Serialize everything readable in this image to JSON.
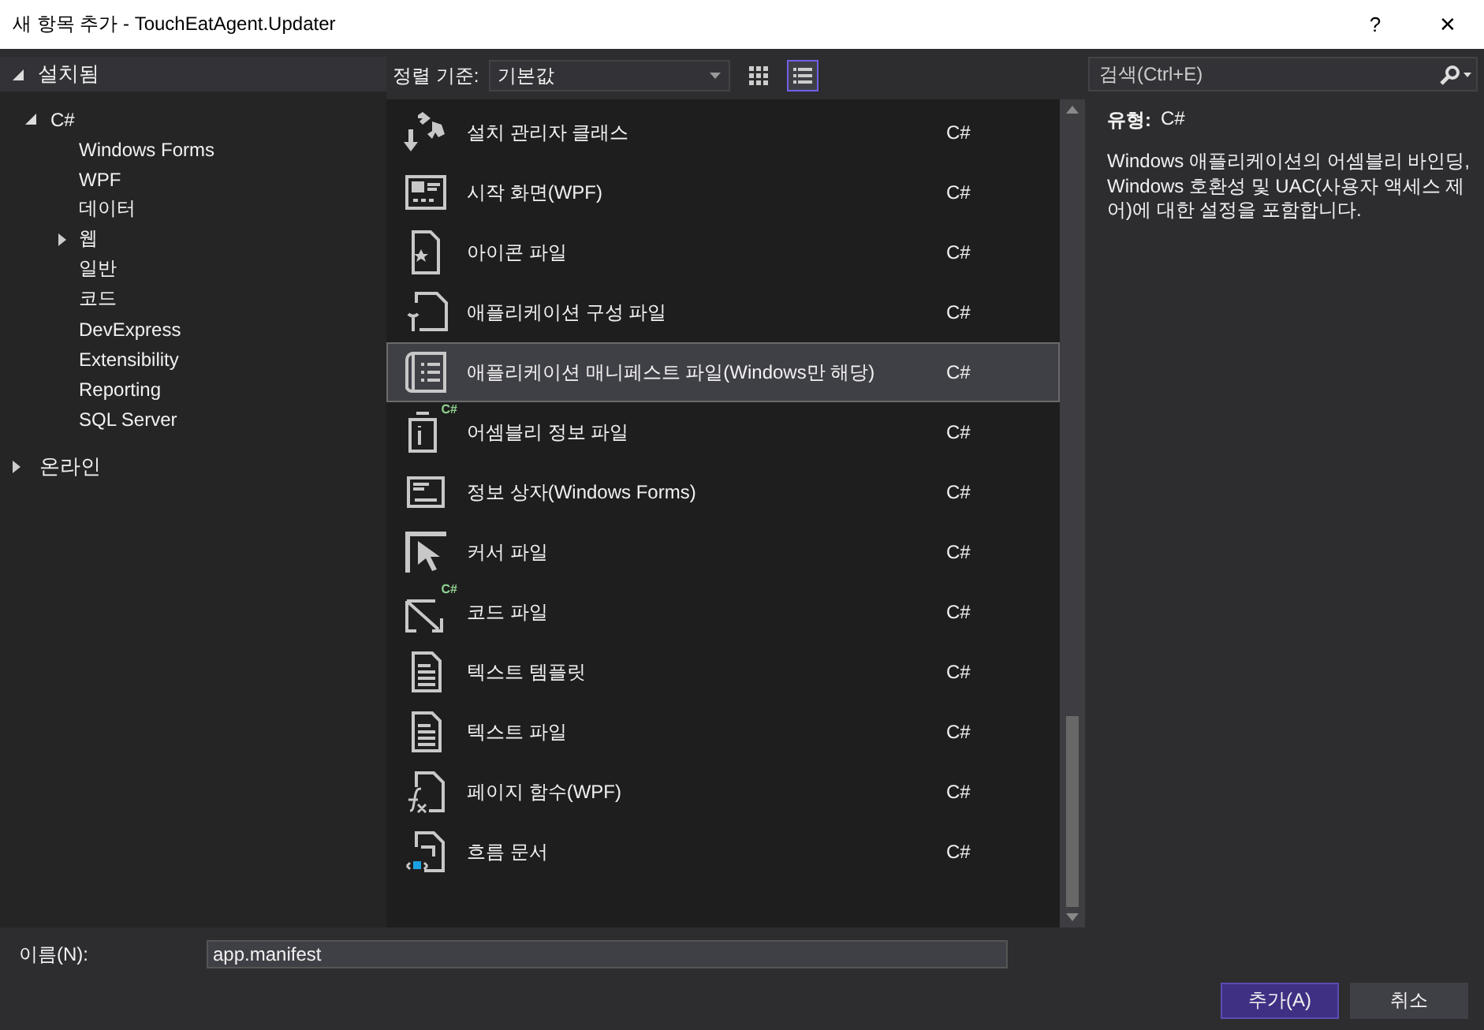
{
  "window": {
    "title": "새 항목 추가 - TouchEatAgent.Updater",
    "help": "?",
    "close": "✕"
  },
  "tree": [
    {
      "label": "설치됨",
      "expanded": true,
      "children": [
        {
          "label": "C#",
          "expanded": true,
          "children": [
            {
              "label": "Windows Forms",
              "selected": false
            },
            {
              "label": "WPF",
              "selected": false
            },
            {
              "label": "데이터",
              "selected": false
            },
            {
              "label": "웹",
              "expanded": false,
              "selected": false
            },
            {
              "label": "일반",
              "selected": false
            },
            {
              "label": "코드",
              "selected": false
            },
            {
              "label": "DevExpress",
              "selected": false
            },
            {
              "label": "Extensibility",
              "selected": false
            },
            {
              "label": "Reporting",
              "selected": false
            },
            {
              "label": "SQL Server",
              "selected": false
            }
          ]
        }
      ]
    },
    {
      "label": "온라인",
      "expanded": false
    }
  ],
  "toolbar": {
    "sort_label": "정렬 기준:",
    "sort_value": "기본값",
    "views": [
      {
        "kind": "grid",
        "selected": false
      },
      {
        "kind": "list",
        "selected": true
      }
    ]
  },
  "templates": [
    {
      "name": "설치 관리자 클래스",
      "language": "C#",
      "selected": false
    },
    {
      "name": "시작 화면(WPF)",
      "language": "C#",
      "selected": false
    },
    {
      "name": "아이콘 파일",
      "language": "C#",
      "selected": false
    },
    {
      "name": "애플리케이션 구성 파일",
      "language": "C#",
      "selected": false
    },
    {
      "name": "애플리케이션 매니페스트 파일(Windows만 해당)",
      "language": "C#",
      "selected": true
    },
    {
      "name": "어셈블리 정보 파일",
      "language": "C#",
      "selected": false,
      "badge": "C#"
    },
    {
      "name": "정보 상자(Windows Forms)",
      "language": "C#",
      "selected": false
    },
    {
      "name": "커서 파일",
      "language": "C#",
      "selected": false
    },
    {
      "name": "코드 파일",
      "language": "C#",
      "selected": false,
      "badge": "C#"
    },
    {
      "name": "텍스트 템플릿",
      "language": "C#",
      "selected": false
    },
    {
      "name": "텍스트 파일",
      "language": "C#",
      "selected": false
    },
    {
      "name": "페이지 함수(WPF)",
      "language": "C#",
      "selected": false
    },
    {
      "name": "흐름 문서",
      "language": "C#",
      "selected": false
    }
  ],
  "search": {
    "placeholder": "검색(Ctrl+E)"
  },
  "details": {
    "type_label": "유형:",
    "type_value": "C#",
    "description": "Windows 애플리케이션의 어셈블리 바인딩, Windows 호환성 및 UAC(사용자 액세스 제어)에 대한 설정을 포함합니다."
  },
  "name_field": {
    "label": "이름(N):",
    "value": "app.manifest"
  },
  "buttons": [
    {
      "label": "추가(A)",
      "kind": "primary"
    },
    {
      "label": "취소",
      "kind": "secondary"
    }
  ]
}
